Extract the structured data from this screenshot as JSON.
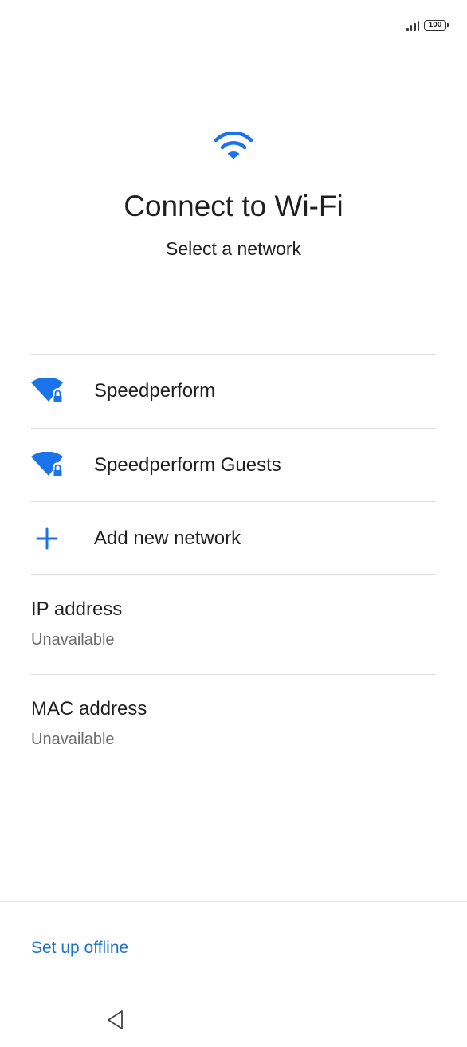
{
  "status_bar": {
    "battery_level": "100",
    "signal_bars": 4
  },
  "header": {
    "icon": "wifi-icon",
    "title": "Connect to Wi-Fi",
    "subtitle": "Select a network"
  },
  "networks": [
    {
      "name": "Speedperform",
      "icon": "wifi-lock-icon",
      "secured": true
    },
    {
      "name": "Speedperform Guests",
      "icon": "wifi-lock-icon",
      "secured": true
    }
  ],
  "add_network": {
    "label": "Add new network",
    "icon": "plus-icon"
  },
  "ip_address": {
    "label": "IP address",
    "value": "Unavailable"
  },
  "mac_address": {
    "label": "MAC address",
    "value": "Unavailable"
  },
  "footer": {
    "offline_label": "Set up offline"
  },
  "nav_bar": {
    "back_icon": "back-triangle-icon"
  },
  "colors": {
    "accent": "#1a73e8",
    "link": "#1a73c8",
    "divider": "#dcdcdc",
    "secondary_text": "#6b6b6b"
  }
}
